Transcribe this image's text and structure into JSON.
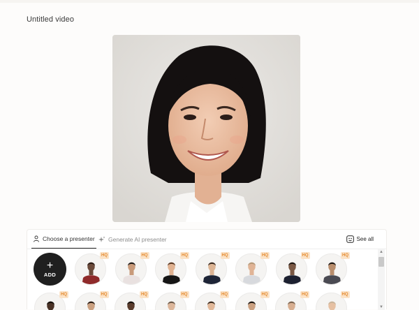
{
  "header": {
    "title": "Untitled video"
  },
  "tabs": [
    {
      "label": "Choose a presenter",
      "icon": "person-icon"
    },
    {
      "label": "Generate AI presenter",
      "icon": "sparkle-icon"
    }
  ],
  "see_all": {
    "label": "See all",
    "icon": "avatar-gallery-icon"
  },
  "add_button": {
    "plus": "+",
    "label": "ADD"
  },
  "badge": "HQ",
  "colors": {
    "accent_dark": "#1f1f1f",
    "hq_bg": "#fbe3c8",
    "hq_text": "#e48a2e"
  },
  "presenters_row1": [
    {
      "shirt": "#8f2a2a",
      "skin": "#6b4a3a",
      "hair": "#2a1a14"
    },
    {
      "shirt": "#e9e1e0",
      "skin": "#c89a7a",
      "hair": "#1e1a18"
    },
    {
      "shirt": "#151515",
      "skin": "#e0b291",
      "hair": "#5b3a24"
    },
    {
      "shirt": "#1d2436",
      "skin": "#dcb494",
      "hair": "#3a2a20"
    },
    {
      "shirt": "#d7d9dd",
      "skin": "#e0b496",
      "hair": "#b69a7a"
    },
    {
      "shirt": "#1c2030",
      "skin": "#7a5844",
      "hair": "#1c1410"
    },
    {
      "shirt": "#4a4a52",
      "skin": "#b88d6c",
      "hair": "#1a1410"
    }
  ],
  "presenters_row2": [
    {
      "shirt": "#e8e8e8",
      "skin": "#4a3226",
      "hair": "#120c08"
    },
    {
      "shirt": "#a8232b",
      "skin": "#caa080",
      "hair": "#2a1c14"
    },
    {
      "shirt": "#7a2b6a",
      "skin": "#5a3c2c",
      "hair": "#140e0a"
    },
    {
      "shirt": "#d8d8d8",
      "skin": "#dcb69a",
      "hair": "#6a5848"
    },
    {
      "shirt": "#f2f2f2",
      "skin": "#e1b899",
      "hair": "#3a2a1e"
    },
    {
      "shirt": "#2a2a2a",
      "skin": "#caa080",
      "hair": "#1a1410"
    },
    {
      "shirt": "#cfcfcf",
      "skin": "#d7ae90",
      "hair": "#7b6450"
    },
    {
      "shirt": "#222222",
      "skin": "#e6c0a2",
      "hair": "#c9b49a"
    }
  ]
}
